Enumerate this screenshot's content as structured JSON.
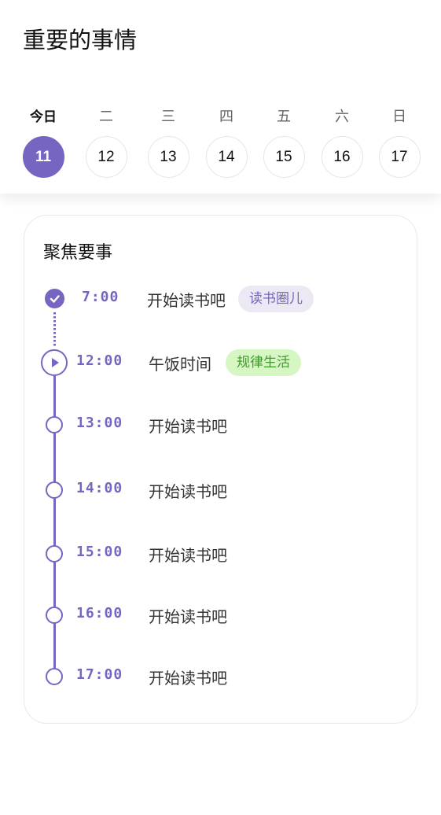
{
  "header": {
    "title": "重要的事情"
  },
  "week": {
    "days": [
      {
        "label": "今日",
        "date": "11",
        "today": true
      },
      {
        "label": "二",
        "date": "12",
        "today": false
      },
      {
        "label": "三",
        "date": "13",
        "today": false
      },
      {
        "label": "四",
        "date": "14",
        "today": false
      },
      {
        "label": "五",
        "date": "15",
        "today": false
      },
      {
        "label": "六",
        "date": "16",
        "today": false
      },
      {
        "label": "日",
        "date": "17",
        "today": false
      }
    ]
  },
  "focus": {
    "title": "聚焦要事",
    "items": [
      {
        "time": "7:00",
        "task": "开始读书吧",
        "tag": "读书圈儿",
        "tag_color": "purple",
        "status": "done",
        "icon": "check-icon"
      },
      {
        "time": "12:00",
        "task": "午饭时间",
        "tag": "规律生活",
        "tag_color": "green",
        "status": "current",
        "icon": "play-icon"
      },
      {
        "time": "13:00",
        "task": "开始读书吧",
        "status": "upcoming"
      },
      {
        "time": "14:00",
        "task": "开始读书吧",
        "status": "upcoming"
      },
      {
        "time": "15:00",
        "task": "开始读书吧",
        "status": "upcoming"
      },
      {
        "time": "16:00",
        "task": "开始读书吧",
        "status": "upcoming"
      },
      {
        "time": "17:00",
        "task": "开始读书吧",
        "status": "upcoming"
      }
    ]
  },
  "colors": {
    "accent": "#7765c1",
    "tag_purple_bg": "#ece9f5",
    "tag_green_bg": "#d6f6c4",
    "tag_green_text": "#3f9a2a"
  }
}
